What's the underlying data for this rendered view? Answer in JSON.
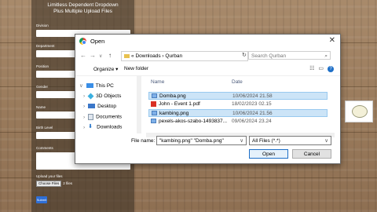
{
  "form": {
    "title_line1": "Limitless Dependent Dropdown",
    "title_line2": "Plus Multiple Upload Files",
    "labels": [
      "Division",
      "Department",
      "Position",
      "Gender",
      "Name",
      "Birth Level",
      "Comments"
    ],
    "upload_label": "Upload your files",
    "choose_button": "Choose Files",
    "choose_status": "2 files",
    "submit_label": "Submit"
  },
  "dialog": {
    "title": "Open",
    "close": "✕",
    "address_prefix": "«",
    "path": [
      "Downloads",
      "Qurban"
    ],
    "path_sep": "›",
    "search_placeholder": "Search Qurban",
    "toolbar": {
      "organize": "Organize ▾",
      "new_folder": "New folder"
    },
    "nav": [
      {
        "label": "This PC",
        "icon": "pc-icon"
      },
      {
        "label": "3D Objects",
        "icon": "cube-icon"
      },
      {
        "label": "Desktop",
        "icon": "desktop-icon"
      },
      {
        "label": "Documents",
        "icon": "documents-icon"
      },
      {
        "label": "Downloads",
        "icon": "download-icon"
      }
    ],
    "columns": {
      "name": "Name",
      "date": "Date"
    },
    "files": [
      {
        "name": "Domba.png",
        "date": "10/06/2024 21.58",
        "type": "image",
        "selected": true
      },
      {
        "name": "John - Event 1.pdf",
        "date": "18/02/2023 02.15",
        "type": "pdf",
        "selected": false
      },
      {
        "name": "kambing.png",
        "date": "10/06/2024 21.56",
        "type": "image",
        "selected": true
      },
      {
        "name": "pexels-akos-szabo-1493837...",
        "date": "09/06/2024 23.24",
        "type": "image",
        "selected": false
      }
    ],
    "filename_label": "File name:",
    "filename_value": "\"kambing.png\" \"Domba.png\"",
    "filetype_value": "All Files (*.*)",
    "open_button": "Open",
    "cancel_button": "Cancel"
  }
}
